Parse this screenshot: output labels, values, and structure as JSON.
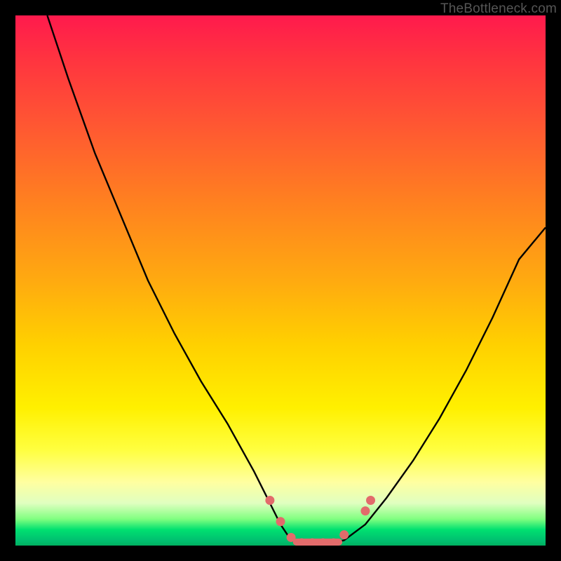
{
  "watermark": "TheBottleneck.com",
  "chart_data": {
    "type": "line",
    "title": "",
    "xlabel": "",
    "ylabel": "",
    "xlim": [
      0,
      100
    ],
    "ylim": [
      0,
      100
    ],
    "grid": false,
    "legend": false,
    "series": [
      {
        "name": "bottleneck-curve",
        "color": "#000000",
        "x": [
          6,
          10,
          15,
          20,
          25,
          30,
          35,
          40,
          45,
          48,
          50,
          52,
          55,
          58,
          62,
          66,
          70,
          75,
          80,
          85,
          90,
          95,
          100
        ],
        "y": [
          100,
          88,
          74,
          62,
          50,
          40,
          31,
          23,
          14,
          8,
          4,
          1,
          0,
          0,
          1,
          4,
          9,
          16,
          24,
          33,
          43,
          54,
          60
        ]
      }
    ],
    "markers": {
      "name": "highlight-dots",
      "color": "#e26b6b",
      "points": [
        {
          "x": 48,
          "y": 8
        },
        {
          "x": 50,
          "y": 4
        },
        {
          "x": 52,
          "y": 1
        },
        {
          "x": 54,
          "y": 0
        },
        {
          "x": 56,
          "y": 0
        },
        {
          "x": 58,
          "y": 0
        },
        {
          "x": 60,
          "y": 0
        },
        {
          "x": 62,
          "y": 1.5
        },
        {
          "x": 66,
          "y": 6
        },
        {
          "x": 67,
          "y": 8
        }
      ]
    },
    "flat_segment": {
      "color": "#e26b6b",
      "x_start": 53,
      "x_end": 61,
      "y": 0
    },
    "background_gradient": {
      "top": "#ff1a4d",
      "mid": "#ffe000",
      "bottom": "#00c070"
    }
  }
}
